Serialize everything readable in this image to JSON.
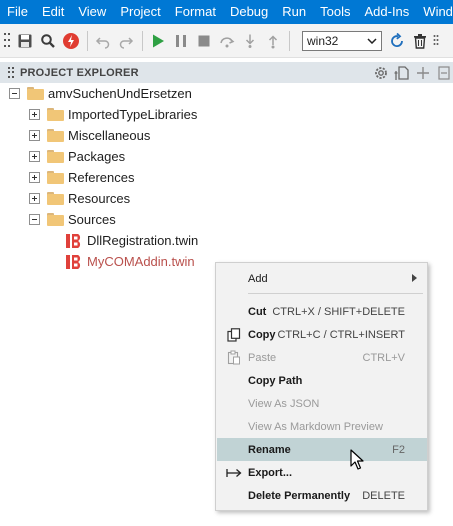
{
  "menubar": {
    "items": [
      "File",
      "Edit",
      "View",
      "Project",
      "Format",
      "Debug",
      "Run",
      "Tools",
      "Add-Ins",
      "Windo"
    ]
  },
  "toolbar": {
    "icons": [
      "save-icon",
      "find-icon",
      "stop-build-icon",
      "undo-icon",
      "redo-icon",
      "run-icon",
      "pause-icon",
      "stop-icon",
      "step-over-icon",
      "step-into-icon",
      "step-out-icon",
      "refresh-icon",
      "delete-icon"
    ],
    "target": "win32"
  },
  "panel": {
    "title": "PROJECT EXPLORER",
    "actions": [
      "settings-icon",
      "new-file-icon",
      "add-icon",
      "collapse-icon"
    ]
  },
  "tree": {
    "root": "amvSuchenUndErsetzen",
    "folders": [
      {
        "label": "ImportedTypeLibraries",
        "expanded": false
      },
      {
        "label": "Miscellaneous",
        "expanded": false
      },
      {
        "label": "Packages",
        "expanded": false
      },
      {
        "label": "References",
        "expanded": false
      },
      {
        "label": "Resources",
        "expanded": false
      },
      {
        "label": "Sources",
        "expanded": true
      }
    ],
    "files": [
      {
        "label": "DllRegistration.twin",
        "selected": false
      },
      {
        "label": "MyCOMAddin.twin",
        "selected": true
      }
    ]
  },
  "context_menu": {
    "add": {
      "label": "Add"
    },
    "cut": {
      "label": "Cut",
      "shortcut": "CTRL+X / SHIFT+DELETE"
    },
    "copy": {
      "label": "Copy",
      "shortcut": "CTRL+C / CTRL+INSERT"
    },
    "paste": {
      "label": "Paste",
      "shortcut": "CTRL+V"
    },
    "copy_path": {
      "label": "Copy Path"
    },
    "view_json": {
      "label": "View As JSON"
    },
    "view_markdown": {
      "label": "View As Markdown Preview"
    },
    "rename": {
      "label": "Rename",
      "shortcut": "F2"
    },
    "export": {
      "label": "Export..."
    },
    "delete": {
      "label": "Delete Permanently",
      "shortcut": "DELETE"
    }
  },
  "colors": {
    "menubar_bg": "#0078d4",
    "panel_header_bg": "#dfe5ea",
    "selected_file_text": "#b9504c",
    "highlight_bg": "#c1d3d5",
    "folder": "#f1c677",
    "run_green": "#2ea043"
  }
}
